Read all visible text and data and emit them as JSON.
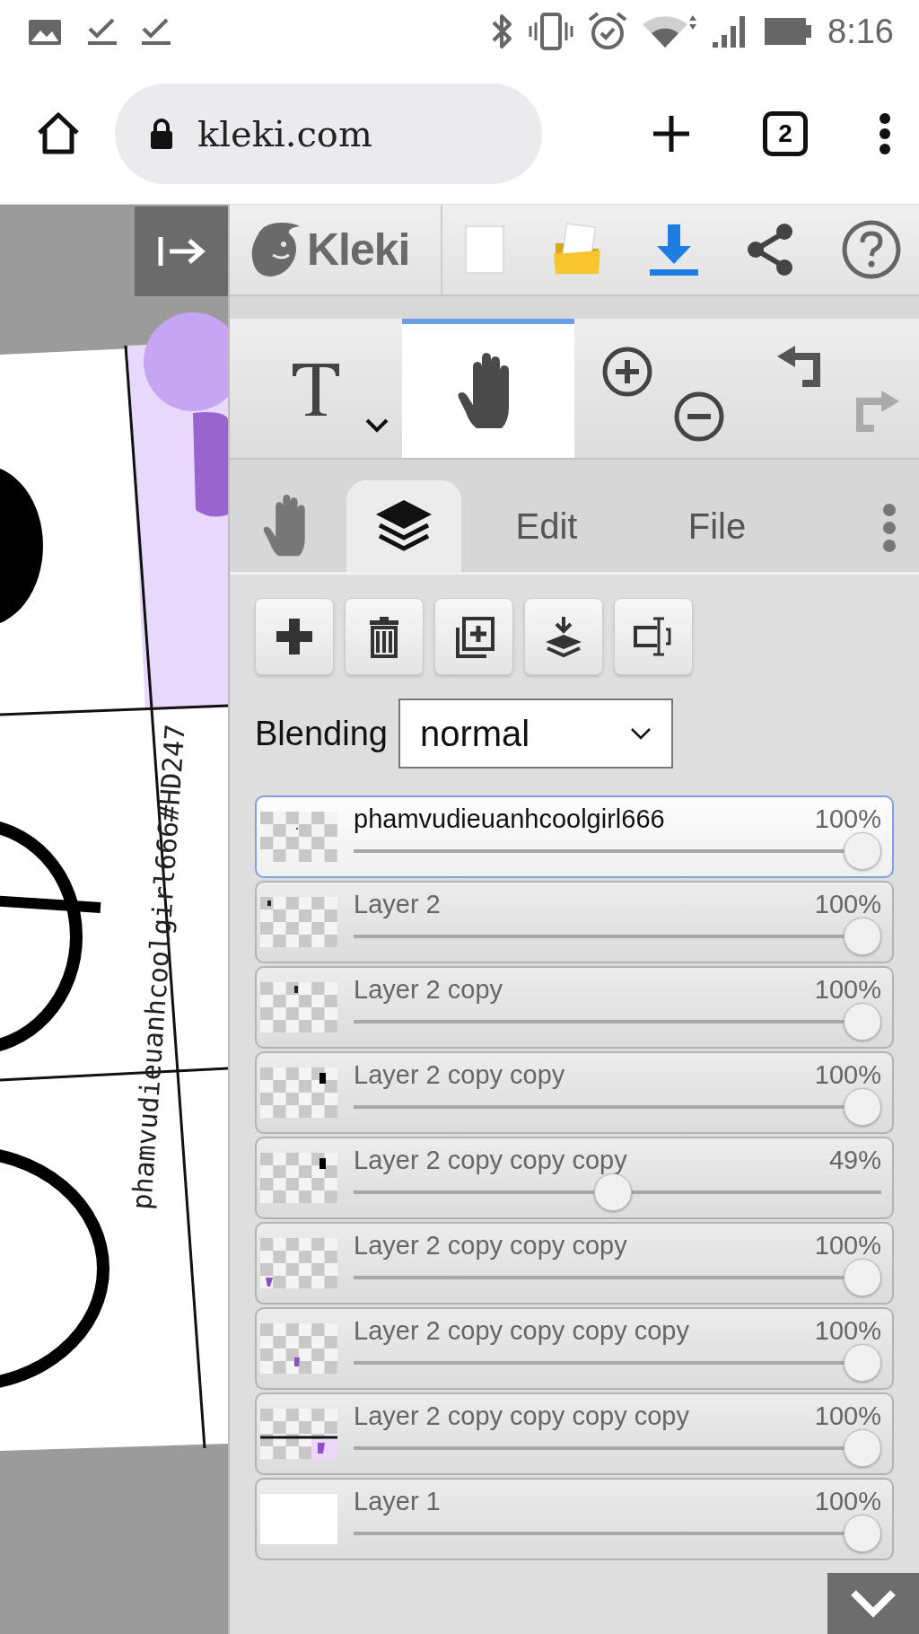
{
  "status_bar": {
    "time": "8:16"
  },
  "browser": {
    "url": "kleki.com",
    "tab_count": "2"
  },
  "app_bar": {
    "logo": "Kleki"
  },
  "tools": [
    {
      "kind": "text",
      "selected": false
    },
    {
      "kind": "hand",
      "selected": true
    }
  ],
  "history": [
    {
      "kind": "undo",
      "disabled": false
    },
    {
      "kind": "redo",
      "disabled": true
    }
  ],
  "tabs": [
    {
      "kind": "hand",
      "selected": false
    },
    {
      "kind": "layers",
      "selected": true
    },
    {
      "kind": "label",
      "label": "Edit",
      "selected": false
    },
    {
      "kind": "label",
      "label": "File",
      "selected": false
    }
  ],
  "blending": {
    "label": "Blending",
    "value": "normal"
  },
  "layers": [
    {
      "name": "phamvudieuanhcoolgirl666",
      "opacity": "100%",
      "level": 1,
      "selected": true
    },
    {
      "name": "Layer 2",
      "opacity": "100%",
      "level": 1,
      "selected": false
    },
    {
      "name": "Layer 2 copy",
      "opacity": "100%",
      "level": 1,
      "selected": false
    },
    {
      "name": "Layer 2 copy copy",
      "opacity": "100%",
      "level": 1,
      "selected": false
    },
    {
      "name": "Layer 2 copy copy copy",
      "opacity": "49%",
      "level": 0.49,
      "selected": false
    },
    {
      "name": "Layer 2 copy copy copy",
      "opacity": "100%",
      "level": 1,
      "selected": false
    },
    {
      "name": "Layer 2 copy copy copy copy",
      "opacity": "100%",
      "level": 1,
      "selected": false
    },
    {
      "name": "Layer 2 copy copy copy copy",
      "opacity": "100%",
      "level": 1,
      "selected": false
    },
    {
      "name": "Layer 1",
      "opacity": "100%",
      "level": 1,
      "selected": false
    }
  ],
  "canvas": {
    "text": "phamvudieuanhcoolgirl666#HD247"
  }
}
